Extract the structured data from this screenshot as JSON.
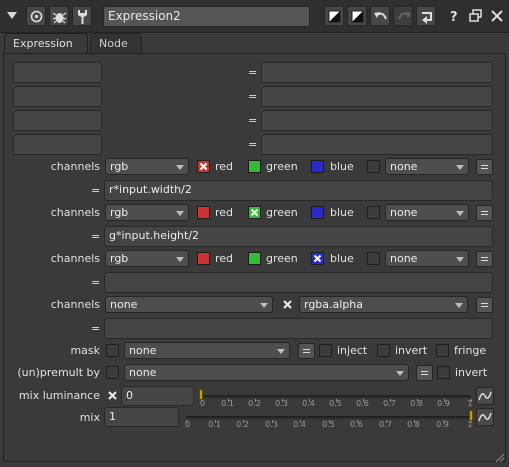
{
  "titlebar": {
    "node_name": "Expression2"
  },
  "tabs": [
    {
      "label": "Expression"
    },
    {
      "label": "Node"
    }
  ],
  "temp_rows": [
    {
      "name": "",
      "eq": "=",
      "expr": ""
    },
    {
      "name": "",
      "eq": "=",
      "expr": ""
    },
    {
      "name": "",
      "eq": "=",
      "expr": ""
    },
    {
      "name": "",
      "eq": "=",
      "expr": ""
    }
  ],
  "channel_sets": [
    {
      "label": "channels",
      "layer": "rgb",
      "checks": [
        {
          "label": "red",
          "checked": true,
          "color": "#cc3333"
        },
        {
          "label": "green",
          "checked": false,
          "color": "#33bb33"
        },
        {
          "label": "blue",
          "checked": false,
          "color": "#2a2acc"
        }
      ],
      "extra": "none",
      "expr_eq": "=",
      "expression": "r*input.width/2"
    },
    {
      "label": "channels",
      "layer": "rgb",
      "checks": [
        {
          "label": "red",
          "checked": false,
          "color": "#cc3333"
        },
        {
          "label": "green",
          "checked": true,
          "color": "#33bb33"
        },
        {
          "label": "blue",
          "checked": false,
          "color": "#2a2acc"
        }
      ],
      "extra": "none",
      "expr_eq": "=",
      "expression": "g*input.height/2"
    },
    {
      "label": "channels",
      "layer": "rgb",
      "checks": [
        {
          "label": "red",
          "checked": false,
          "color": "#cc3333"
        },
        {
          "label": "green",
          "checked": false,
          "color": "#33bb33"
        },
        {
          "label": "blue",
          "checked": true,
          "color": "#2a2acc"
        }
      ],
      "extra": "none",
      "expr_eq": "=",
      "expression": ""
    }
  ],
  "channels4": {
    "label": "channels",
    "layer": "none",
    "extra": "rgba.alpha",
    "checked": true,
    "expr_eq": "=",
    "expression": ""
  },
  "mask": {
    "label": "mask",
    "value": "none",
    "inject_label": "inject",
    "invert_label": "invert",
    "fringe_label": "fringe"
  },
  "premult": {
    "label": "(un)premult by",
    "value": "none",
    "invert_label": "invert"
  },
  "mix_luminance": {
    "label": "mix luminance",
    "value": "0",
    "enabled": true,
    "ticks": [
      "0",
      "0.1",
      "0.2",
      "0.3",
      "0.4",
      "0.5",
      "0.6",
      "0.7",
      "0.8",
      "0.9",
      "1"
    ],
    "position": 0
  },
  "mix": {
    "label": "mix",
    "value": "1",
    "ticks": [
      "0",
      "0.1",
      "0.2",
      "0.3",
      "0.4",
      "0.5",
      "0.6",
      "0.7",
      "0.8",
      "0.9",
      "1"
    ],
    "position": 1
  },
  "icons": {
    "collapse": "triangle-down-icon",
    "node_dot": "circle-dot-icon",
    "bug": "bug-icon",
    "wrench": "wrench-icon",
    "color1": "color-swatch-icon",
    "color2": "color-swatch-icon",
    "undo": "undo-icon",
    "redo": "redo-icon",
    "revert": "revert-icon",
    "help": "help-icon",
    "float": "float-window-icon",
    "close": "close-icon"
  },
  "colors": {
    "panel_bg": "#3a3a3a",
    "accent_handle": "#c8a000",
    "check_x": "#ffffff"
  }
}
